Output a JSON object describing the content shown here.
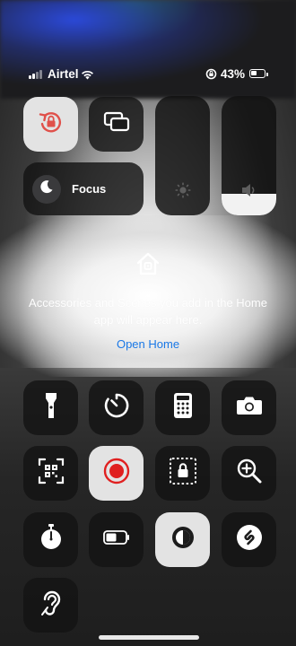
{
  "status_bar": {
    "carrier": "Airtel",
    "battery_percent": "43%",
    "battery_level": 0.43,
    "icons": [
      "signal-icon",
      "wifi-icon",
      "orientation-lock-status-icon",
      "battery-icon"
    ]
  },
  "controls": {
    "orientation_lock": {
      "icon": "orientation-lock-icon",
      "active": true,
      "accent": "#e0504a"
    },
    "screen_mirroring": {
      "icon": "screen-mirroring-icon"
    },
    "focus": {
      "label": "Focus",
      "icon": "moon-icon"
    },
    "brightness": {
      "icon": "sun-icon",
      "level": 0.0
    },
    "volume": {
      "icon": "speaker-icon",
      "level": 0.18
    }
  },
  "home": {
    "message": "Accessories and Scenes you add in the Home app will appear here.",
    "link": "Open Home",
    "link_color": "#1a78e6",
    "icon": "home-icon"
  },
  "grid": [
    {
      "name": "flashlight",
      "icon": "flashlight-icon",
      "active": false
    },
    {
      "name": "timer",
      "icon": "timer-icon",
      "active": false
    },
    {
      "name": "calculator",
      "icon": "calculator-icon",
      "active": false
    },
    {
      "name": "camera",
      "icon": "camera-icon",
      "active": false
    },
    {
      "name": "code-scanner",
      "icon": "qr-code-icon",
      "active": false
    },
    {
      "name": "screen-recording",
      "icon": "record-icon",
      "active": true,
      "accent": "#e02020"
    },
    {
      "name": "guided-access",
      "icon": "guided-access-icon",
      "active": false
    },
    {
      "name": "magnifier",
      "icon": "magnifier-icon",
      "active": false
    },
    {
      "name": "stopwatch",
      "icon": "stopwatch-icon",
      "active": false
    },
    {
      "name": "low-power-mode",
      "icon": "battery-mode-icon",
      "active": false
    },
    {
      "name": "dark-mode",
      "icon": "dark-mode-icon",
      "active": true
    },
    {
      "name": "shazam",
      "icon": "shazam-icon",
      "active": false
    },
    {
      "name": "hearing",
      "icon": "ear-icon",
      "active": false
    }
  ]
}
